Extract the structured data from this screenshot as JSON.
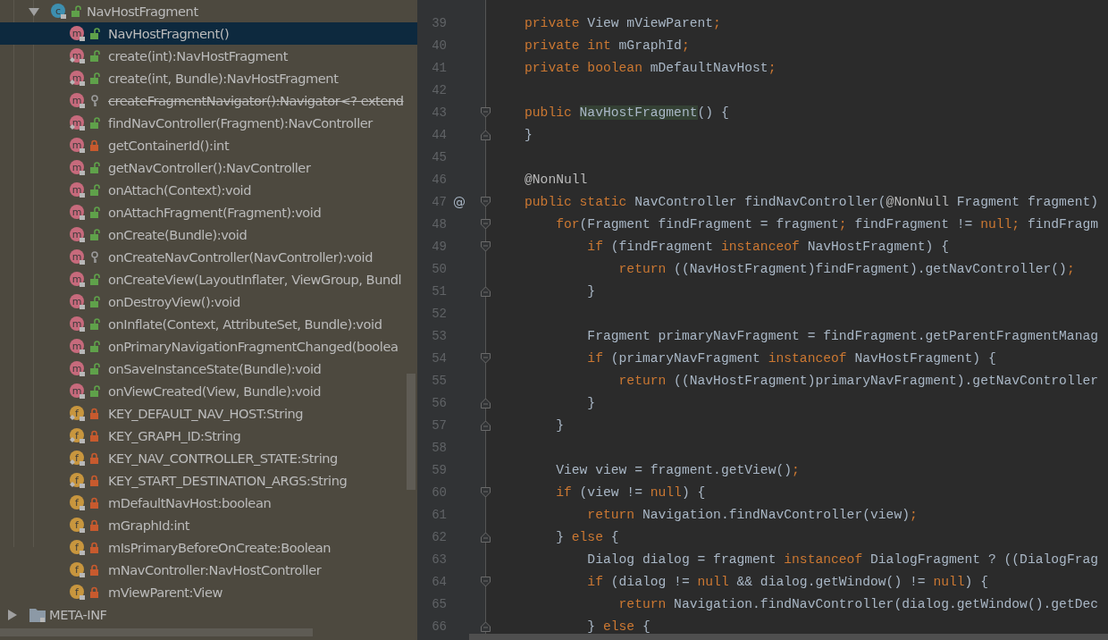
{
  "project_tree": {
    "items": [
      {
        "label": "NavHostFragment",
        "kind": "class",
        "badge": "c",
        "locked": false,
        "protected": false,
        "expanded": true,
        "children": [
          {
            "label": "NavHostFragment()",
            "kind": "method",
            "badge": "m",
            "locked": false,
            "protected": false,
            "static": false,
            "deprecated": false,
            "selected": true
          },
          {
            "label": "create(int):NavHostFragment",
            "kind": "method",
            "badge": "m",
            "locked": false,
            "protected": false,
            "static": true,
            "deprecated": false,
            "selected": false
          },
          {
            "label": "create(int, Bundle):NavHostFragment",
            "kind": "method",
            "badge": "m",
            "locked": false,
            "protected": false,
            "static": true,
            "deprecated": false,
            "selected": false
          },
          {
            "label": "createFragmentNavigator():Navigator<? extend",
            "kind": "method",
            "badge": "m",
            "locked": false,
            "protected": true,
            "static": false,
            "deprecated": true,
            "selected": false
          },
          {
            "label": "findNavController(Fragment):NavController",
            "kind": "method",
            "badge": "m",
            "locked": false,
            "protected": false,
            "static": true,
            "deprecated": false,
            "selected": false
          },
          {
            "label": "getContainerId():int",
            "kind": "method",
            "badge": "m",
            "locked": true,
            "protected": false,
            "static": false,
            "deprecated": false,
            "selected": false
          },
          {
            "label": "getNavController():NavController",
            "kind": "method",
            "badge": "m",
            "locked": false,
            "protected": false,
            "static": false,
            "deprecated": false,
            "selected": false
          },
          {
            "label": "onAttach(Context):void",
            "kind": "method",
            "badge": "m",
            "locked": false,
            "protected": false,
            "static": false,
            "deprecated": false,
            "selected": false
          },
          {
            "label": "onAttachFragment(Fragment):void",
            "kind": "method",
            "badge": "m",
            "locked": false,
            "protected": false,
            "static": false,
            "deprecated": false,
            "selected": false
          },
          {
            "label": "onCreate(Bundle):void",
            "kind": "method",
            "badge": "m",
            "locked": false,
            "protected": false,
            "static": false,
            "deprecated": false,
            "selected": false
          },
          {
            "label": "onCreateNavController(NavController):void",
            "kind": "method",
            "badge": "m",
            "locked": false,
            "protected": true,
            "static": false,
            "deprecated": false,
            "selected": false
          },
          {
            "label": "onCreateView(LayoutInflater, ViewGroup, Bundl",
            "kind": "method",
            "badge": "m",
            "locked": false,
            "protected": false,
            "static": false,
            "deprecated": false,
            "selected": false
          },
          {
            "label": "onDestroyView():void",
            "kind": "method",
            "badge": "m",
            "locked": false,
            "protected": false,
            "static": false,
            "deprecated": false,
            "selected": false
          },
          {
            "label": "onInflate(Context, AttributeSet, Bundle):void",
            "kind": "method",
            "badge": "m",
            "locked": false,
            "protected": false,
            "static": false,
            "deprecated": false,
            "selected": false
          },
          {
            "label": "onPrimaryNavigationFragmentChanged(boolea",
            "kind": "method",
            "badge": "m",
            "locked": false,
            "protected": false,
            "static": false,
            "deprecated": false,
            "selected": false
          },
          {
            "label": "onSaveInstanceState(Bundle):void",
            "kind": "method",
            "badge": "m",
            "locked": false,
            "protected": false,
            "static": false,
            "deprecated": false,
            "selected": false
          },
          {
            "label": "onViewCreated(View, Bundle):void",
            "kind": "method",
            "badge": "m",
            "locked": false,
            "protected": false,
            "static": false,
            "deprecated": false,
            "selected": false
          },
          {
            "label": "KEY_DEFAULT_NAV_HOST:String",
            "kind": "field",
            "badge": "f",
            "locked": true,
            "protected": false,
            "static": true,
            "deprecated": false,
            "selected": false
          },
          {
            "label": "KEY_GRAPH_ID:String",
            "kind": "field",
            "badge": "f",
            "locked": true,
            "protected": false,
            "static": true,
            "deprecated": false,
            "selected": false
          },
          {
            "label": "KEY_NAV_CONTROLLER_STATE:String",
            "kind": "field",
            "badge": "f",
            "locked": true,
            "protected": false,
            "static": true,
            "deprecated": false,
            "selected": false
          },
          {
            "label": "KEY_START_DESTINATION_ARGS:String",
            "kind": "field",
            "badge": "f",
            "locked": true,
            "protected": false,
            "static": true,
            "deprecated": false,
            "selected": false
          },
          {
            "label": "mDefaultNavHost:boolean",
            "kind": "field",
            "badge": "f",
            "locked": true,
            "protected": false,
            "static": false,
            "deprecated": false,
            "selected": false
          },
          {
            "label": "mGraphId:int",
            "kind": "field",
            "badge": "f",
            "locked": true,
            "protected": false,
            "static": false,
            "deprecated": false,
            "selected": false
          },
          {
            "label": "mIsPrimaryBeforeOnCreate:Boolean",
            "kind": "field",
            "badge": "f",
            "locked": true,
            "protected": false,
            "static": false,
            "deprecated": false,
            "selected": false
          },
          {
            "label": "mNavController:NavHostController",
            "kind": "field",
            "badge": "f",
            "locked": true,
            "protected": false,
            "static": false,
            "deprecated": false,
            "selected": false
          },
          {
            "label": "mViewParent:View",
            "kind": "field",
            "badge": "f",
            "locked": true,
            "protected": false,
            "static": false,
            "deprecated": false,
            "selected": false
          }
        ]
      },
      {
        "label": "META-INF",
        "kind": "folder",
        "expanded": false
      }
    ]
  },
  "editor": {
    "lines": [
      {
        "number": "39",
        "fold_start": false,
        "fold_end": false,
        "tokens": [
          {
            "text": "private",
            "kind": "keyword"
          },
          {
            "text": " View mViewParent",
            "kind": "plain"
          },
          {
            "text": ";",
            "kind": "keyword"
          }
        ]
      },
      {
        "number": "40",
        "fold_start": false,
        "fold_end": false,
        "tokens": [
          {
            "text": "private int",
            "kind": "keyword"
          },
          {
            "text": " mGraphId",
            "kind": "plain"
          },
          {
            "text": ";",
            "kind": "keyword"
          }
        ]
      },
      {
        "number": "41",
        "fold_start": false,
        "fold_end": false,
        "tokens": [
          {
            "text": "private boolean",
            "kind": "keyword"
          },
          {
            "text": " mDefaultNavHost",
            "kind": "plain"
          },
          {
            "text": ";",
            "kind": "keyword"
          }
        ]
      },
      {
        "number": "42",
        "fold_start": false,
        "fold_end": false
      },
      {
        "number": "43",
        "fold_start": true,
        "fold_end": false,
        "tokens": [
          {
            "text": "public ",
            "kind": "keyword"
          },
          {
            "text": "NavHostFragment",
            "kind": "highlight"
          },
          {
            "text": "() {",
            "kind": "plain"
          }
        ]
      },
      {
        "number": "44",
        "fold_start": false,
        "fold_end": true,
        "tokens": [
          {
            "text": "}",
            "kind": "plain"
          }
        ]
      },
      {
        "number": "45",
        "fold_start": false,
        "fold_end": false
      },
      {
        "number": "46",
        "fold_start": false,
        "fold_end": false,
        "tokens": [
          {
            "text": "@NonNull",
            "kind": "annotation"
          }
        ]
      },
      {
        "number": "47",
        "fold_start": true,
        "fold_end": false,
        "gutter_mark": "@",
        "tokens": [
          {
            "text": "public static",
            "kind": "keyword"
          },
          {
            "text": " NavController findNavController(",
            "kind": "plain"
          },
          {
            "text": "@NonNull",
            "kind": "annotation"
          },
          {
            "text": " Fragment fragment)",
            "kind": "plain"
          }
        ]
      },
      {
        "number": "48",
        "fold_start": true,
        "fold_end": false,
        "tokens": [
          {
            "text": "    for",
            "kind": "keyword"
          },
          {
            "text": "(Fragment findFragment = fragment",
            "kind": "plain"
          },
          {
            "text": ";",
            "kind": "keyword"
          },
          {
            "text": " findFragment != ",
            "kind": "plain"
          },
          {
            "text": "null;",
            "kind": "keyword"
          },
          {
            "text": " findFragm",
            "kind": "plain"
          }
        ]
      },
      {
        "number": "49",
        "fold_start": true,
        "fold_end": false,
        "tokens": [
          {
            "text": "        if",
            "kind": "keyword"
          },
          {
            "text": " (findFragment ",
            "kind": "plain"
          },
          {
            "text": "instanceof",
            "kind": "keyword"
          },
          {
            "text": " NavHostFragment) {",
            "kind": "plain"
          }
        ]
      },
      {
        "number": "50",
        "fold_start": false,
        "fold_end": false,
        "tokens": [
          {
            "text": "            return",
            "kind": "keyword"
          },
          {
            "text": " ((NavHostFragment)findFragment).getNavController()",
            "kind": "plain"
          },
          {
            "text": ";",
            "kind": "keyword"
          }
        ]
      },
      {
        "number": "51",
        "fold_start": false,
        "fold_end": true,
        "tokens": [
          {
            "text": "        }",
            "kind": "plain"
          }
        ]
      },
      {
        "number": "52",
        "fold_start": false,
        "fold_end": false
      },
      {
        "number": "53",
        "fold_start": false,
        "fold_end": false,
        "tokens": [
          {
            "text": "        Fragment primaryNavFragment = findFragment.getParentFragmentManag",
            "kind": "plain"
          }
        ]
      },
      {
        "number": "54",
        "fold_start": true,
        "fold_end": false,
        "tokens": [
          {
            "text": "        if",
            "kind": "keyword"
          },
          {
            "text": " (primaryNavFragment ",
            "kind": "plain"
          },
          {
            "text": "instanceof",
            "kind": "keyword"
          },
          {
            "text": " NavHostFragment) {",
            "kind": "plain"
          }
        ]
      },
      {
        "number": "55",
        "fold_start": false,
        "fold_end": false,
        "tokens": [
          {
            "text": "            return",
            "kind": "keyword"
          },
          {
            "text": " ((NavHostFragment)primaryNavFragment).getNavController",
            "kind": "plain"
          }
        ]
      },
      {
        "number": "56",
        "fold_start": false,
        "fold_end": true,
        "tokens": [
          {
            "text": "        }",
            "kind": "plain"
          }
        ]
      },
      {
        "number": "57",
        "fold_start": false,
        "fold_end": true,
        "tokens": [
          {
            "text": "    }",
            "kind": "plain"
          }
        ]
      },
      {
        "number": "58",
        "fold_start": false,
        "fold_end": false
      },
      {
        "number": "59",
        "fold_start": false,
        "fold_end": false,
        "tokens": [
          {
            "text": "    View view = fragment.getView()",
            "kind": "plain"
          },
          {
            "text": ";",
            "kind": "keyword"
          }
        ]
      },
      {
        "number": "60",
        "fold_start": true,
        "fold_end": false,
        "tokens": [
          {
            "text": "    if",
            "kind": "keyword"
          },
          {
            "text": " (view != ",
            "kind": "plain"
          },
          {
            "text": "null",
            "kind": "keyword"
          },
          {
            "text": ") {",
            "kind": "plain"
          }
        ]
      },
      {
        "number": "61",
        "fold_start": false,
        "fold_end": false,
        "tokens": [
          {
            "text": "        return",
            "kind": "keyword"
          },
          {
            "text": " Navigation.findNavController(view)",
            "kind": "plain"
          },
          {
            "text": ";",
            "kind": "keyword"
          }
        ]
      },
      {
        "number": "62",
        "fold_start": false,
        "fold_end": true,
        "tokens": [
          {
            "text": "    } ",
            "kind": "plain"
          },
          {
            "text": "else",
            "kind": "keyword"
          },
          {
            "text": " {",
            "kind": "plain"
          }
        ]
      },
      {
        "number": "63",
        "fold_start": false,
        "fold_end": false,
        "tokens": [
          {
            "text": "        Dialog dialog = fragment ",
            "kind": "plain"
          },
          {
            "text": "instanceof",
            "kind": "keyword"
          },
          {
            "text": " DialogFragment ? ((DialogFrag",
            "kind": "plain"
          }
        ]
      },
      {
        "number": "64",
        "fold_start": true,
        "fold_end": false,
        "tokens": [
          {
            "text": "        if",
            "kind": "keyword"
          },
          {
            "text": " (dialog != ",
            "kind": "plain"
          },
          {
            "text": "null",
            "kind": "keyword"
          },
          {
            "text": " && dialog.getWindow() != ",
            "kind": "plain"
          },
          {
            "text": "null",
            "kind": "keyword"
          },
          {
            "text": ") {",
            "kind": "plain"
          }
        ]
      },
      {
        "number": "65",
        "fold_start": false,
        "fold_end": false,
        "tokens": [
          {
            "text": "            return",
            "kind": "keyword"
          },
          {
            "text": " Navigation.findNavController(dialog.getWindow().getDec",
            "kind": "plain"
          }
        ]
      },
      {
        "number": "66",
        "fold_start": false,
        "fold_end": true,
        "tokens": [
          {
            "text": "        } ",
            "kind": "plain"
          },
          {
            "text": "else",
            "kind": "keyword"
          },
          {
            "text": " {",
            "kind": "plain"
          }
        ]
      }
    ]
  }
}
